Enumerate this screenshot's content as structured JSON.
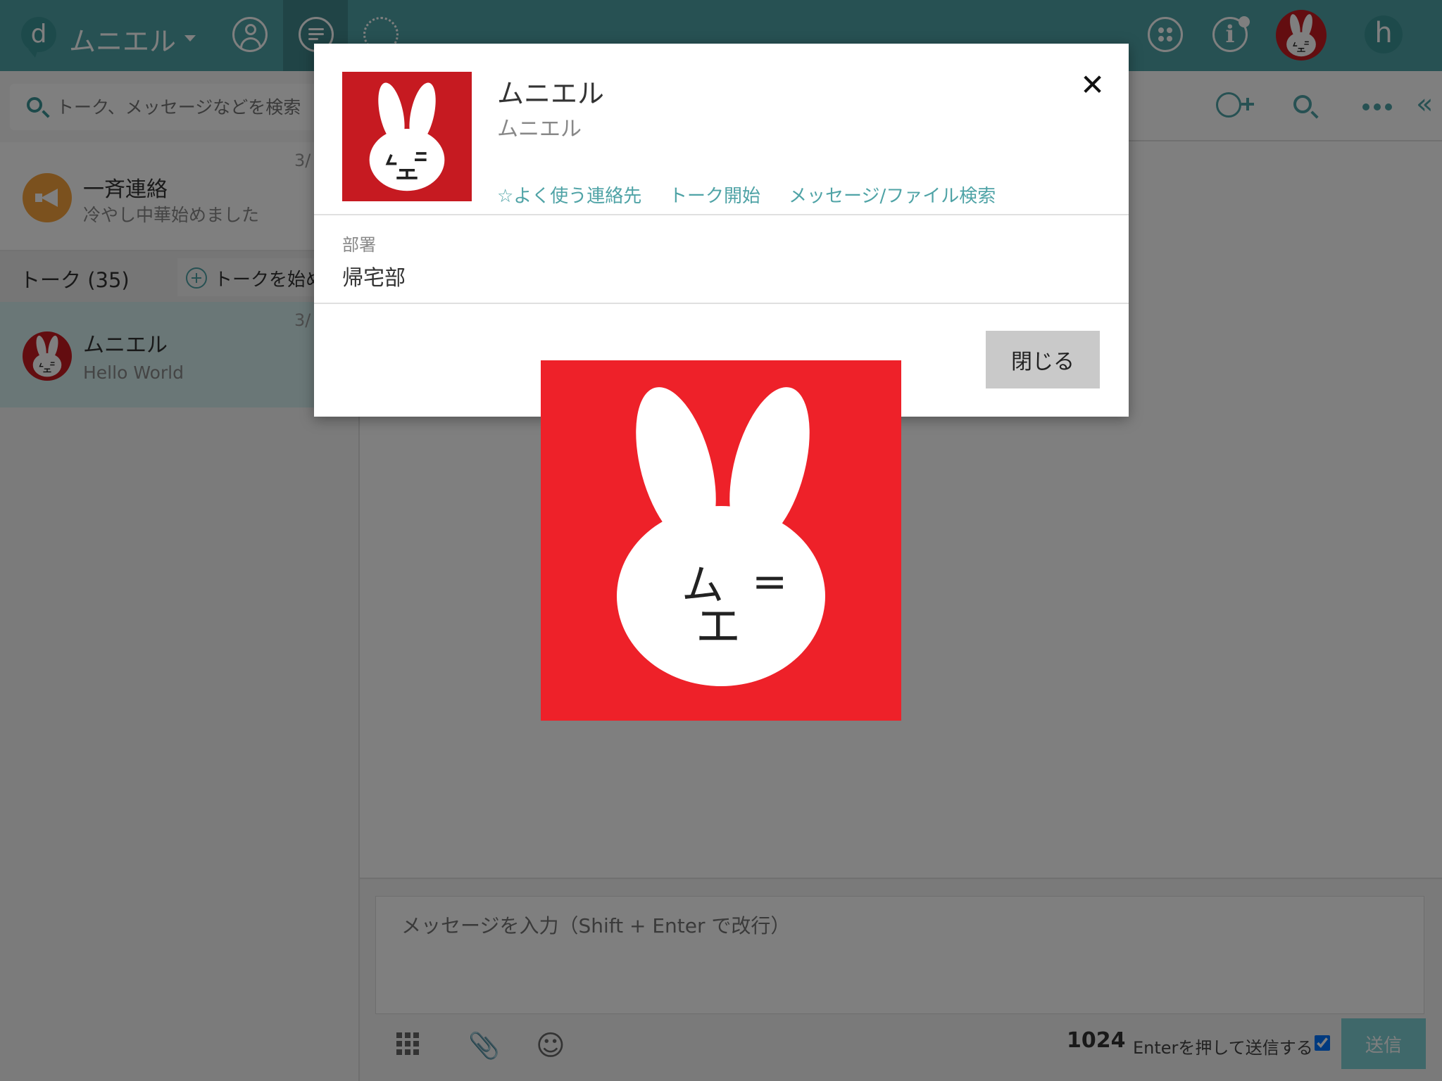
{
  "header": {
    "app_title": "ムニエル",
    "logo_letter": "d",
    "h_letter": "h",
    "accent_color": "#4fa3a6"
  },
  "sidebar": {
    "search_placeholder": "トーク、メッセージなどを検索",
    "broadcast": {
      "title": "一斉連絡",
      "subtitle": "冷やし中華始めました",
      "date": "3/"
    },
    "talk_header": {
      "count_label": "トーク (35)",
      "start_talk_label": "トークを始める"
    },
    "talks": [
      {
        "name": "ムニエル",
        "last_message": "Hello World",
        "date": "3/"
      }
    ]
  },
  "composer": {
    "placeholder": "メッセージを入力（Shift + Enter で改行）",
    "char_count": "1024",
    "enter_to_send_label": "Enterを押して送信する",
    "enter_to_send_checked": true,
    "send_label": "送信"
  },
  "modal": {
    "name": "ムニエル",
    "subname": "ムニエル",
    "links": {
      "favorite": "☆よく使う連絡先",
      "start_talk": "トーク開始",
      "search": "メッセージ/ファイル検索"
    },
    "field_label": "部署",
    "field_value": "帰宅部",
    "close_label": "閉じる"
  },
  "icons": {
    "close": "close-icon",
    "collapse": "«",
    "clip": "📎",
    "smile": "☺",
    "info": "i"
  },
  "zoom_image": {
    "face_text_left": "ム",
    "face_text_right": "=",
    "mouth_text": "エ",
    "background_color": "#ee2129"
  }
}
